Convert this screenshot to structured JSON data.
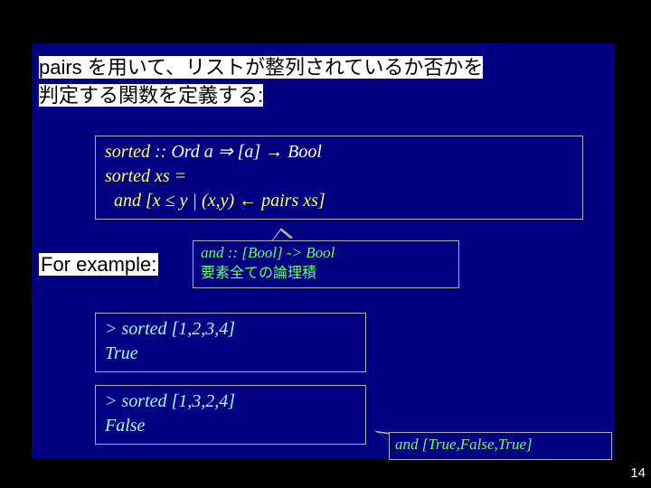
{
  "heading": {
    "line1": "pairs を用いて、リストが整列されているか否かを",
    "line2": "判定する関数を定義する:"
  },
  "def": {
    "l1a": "sorted",
    "l1b": " :: Ord a ",
    "l1arrow1": "⇒",
    "l1c": " [a] ",
    "l1arrow2": "→",
    "l1d": " Bool",
    "l2": "sorted xs =",
    "l3a": "  and [x ",
    "l3le": "≤",
    "l3b": " y | (x,y) ",
    "l3arrow": "←",
    "l3c": " pairs xs]"
  },
  "example_label": "For example:",
  "andbox": {
    "sig": "and :: [Bool] -> Bool",
    "desc": "要素全ての論理積"
  },
  "ex1": {
    "call": "> sorted [1,2,3,4]",
    "result": "True"
  },
  "ex2": {
    "call": "> sorted [1,3,2,4]",
    "result": "False"
  },
  "resultbox": "and [True,False,True]",
  "pagenum": "14"
}
